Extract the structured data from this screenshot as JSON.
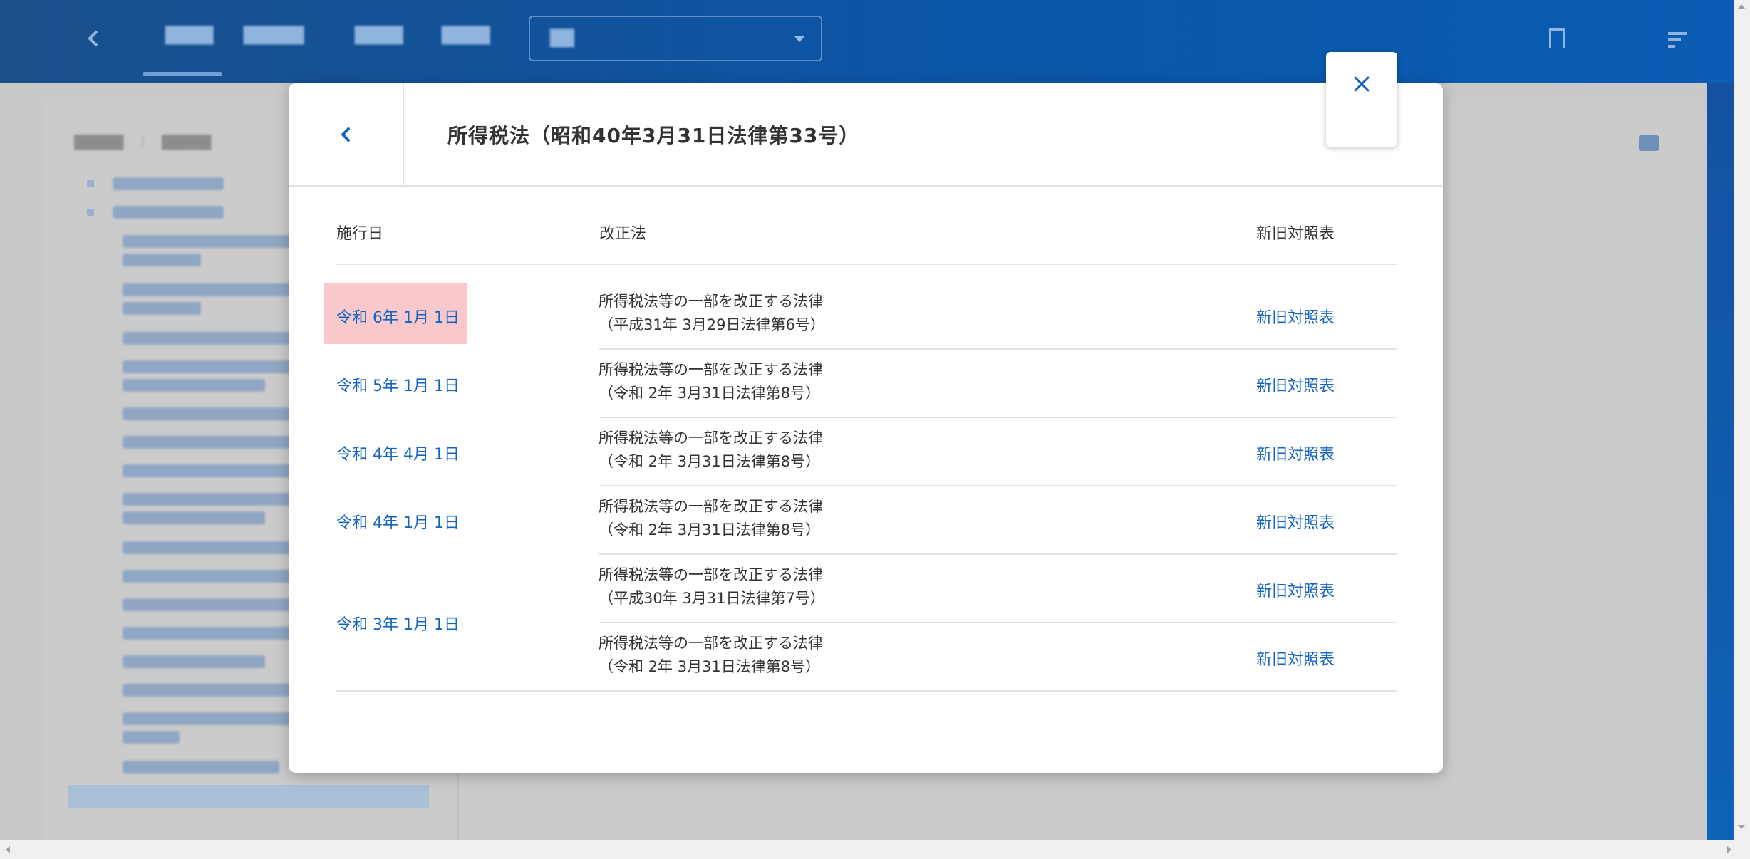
{
  "modal": {
    "title": "所得税法（昭和40年3月31日法律第33号）",
    "columns": {
      "date": "施行日",
      "law": "改正法",
      "compare": "新旧対照表"
    },
    "rows": [
      {
        "date": "令和 6年 1月 1日",
        "law_line1": "所得税法等の一部を改正する法律",
        "law_line2": "（平成31年 3月29日法律第6号）",
        "compare": "新旧対照表",
        "highlighted": true
      },
      {
        "date": "令和 5年 1月 1日",
        "law_line1": "所得税法等の一部を改正する法律",
        "law_line2": "（令和 2年 3月31日法律第8号）",
        "compare": "新旧対照表"
      },
      {
        "date": "令和 4年 4月 1日",
        "law_line1": "所得税法等の一部を改正する法律",
        "law_line2": "（令和 2年 3月31日法律第8号）",
        "compare": "新旧対照表"
      },
      {
        "date": "令和 4年 1月 1日",
        "law_line1": "所得税法等の一部を改正する法律",
        "law_line2": "（令和 2年 3月31日法律第8号）",
        "compare": "新旧対照表"
      },
      {
        "date": "令和 3年 1月 1日",
        "law_line1": "所得税法等の一部を改正する法律",
        "law_line2": "（平成30年 3月31日法律第7号）",
        "compare": "新旧対照表",
        "sub_law_line1": "所得税法等の一部を改正する法律",
        "sub_law_line2": "（令和 2年 3月31日法律第8号）",
        "sub_compare": "新旧対照表"
      }
    ]
  },
  "icons": {
    "back": "chevron-left-icon",
    "close": "close-icon",
    "app_back": "chevron-left-icon",
    "bookmark": "bookmark-icon",
    "notes": "notes-icon",
    "edit": "edit-icon"
  },
  "colors": {
    "link": "#1565c0",
    "highlight": "#f8c8cd",
    "header_bar": "#0b55a6"
  }
}
